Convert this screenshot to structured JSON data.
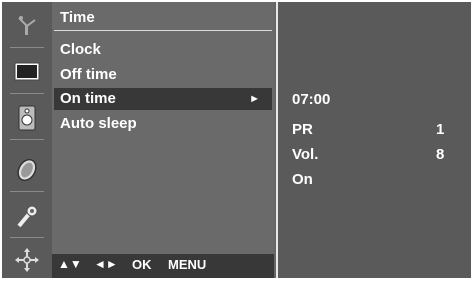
{
  "menu": {
    "title": "Time",
    "items": [
      {
        "label": "Clock"
      },
      {
        "label": "Off time"
      },
      {
        "label": "On time",
        "arrow": "►"
      },
      {
        "label": "Auto sleep"
      }
    ]
  },
  "footer": {
    "updown": "▲▼",
    "leftright": "◄►",
    "ok": "OK",
    "menu": "MENU"
  },
  "panel": {
    "time": "07:00",
    "pr_label": "PR",
    "pr_value": "1",
    "vol_label": "Vol.",
    "vol_value": "8",
    "state": "On"
  },
  "icons": [
    "antenna-icon",
    "screen-icon",
    "speaker-icon",
    "clock-icon",
    "key-icon",
    "options-icon"
  ]
}
